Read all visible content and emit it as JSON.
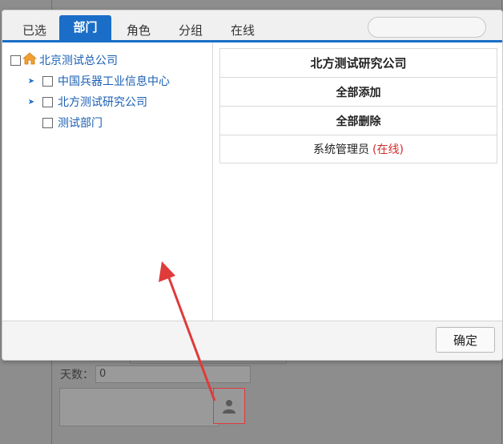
{
  "tabs": [
    {
      "label": "已选",
      "active": false
    },
    {
      "label": "部门",
      "active": true
    },
    {
      "label": "角色",
      "active": false
    },
    {
      "label": "分组",
      "active": false
    },
    {
      "label": "在线",
      "active": false
    }
  ],
  "search": {
    "placeholder": ""
  },
  "tree": {
    "root": {
      "label": "北京测试总公司",
      "icon": "home-icon"
    },
    "children": [
      {
        "label": "中国兵器工业信息中心",
        "expandable": true
      },
      {
        "label": "北方测试研究公司",
        "expandable": true
      },
      {
        "label": "测试部门",
        "expandable": false
      }
    ]
  },
  "right_panel": {
    "title": "北方测试研究公司",
    "add_all": "全部添加",
    "delete_all": "全部删除",
    "member": {
      "name": "系统管理员",
      "status": "(在线)"
    }
  },
  "footer": {
    "confirm_label": "确定"
  },
  "background_form": {
    "days_label": "天数：",
    "days_value": "0",
    "user_picker_icon": "user-icon"
  },
  "colors": {
    "accent": "#1a6ec7",
    "link": "#1a5fb4",
    "online": "#d42a2a",
    "annotation": "#e03a3a"
  }
}
